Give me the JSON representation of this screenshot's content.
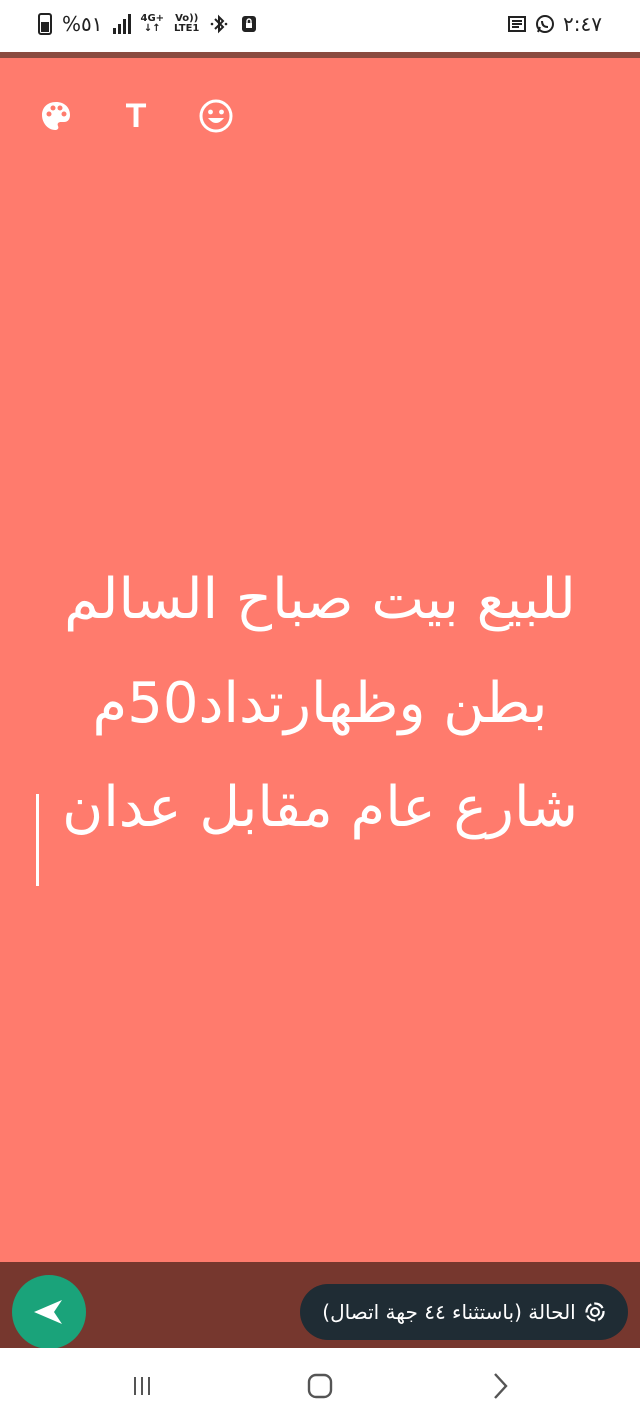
{
  "status_bar": {
    "battery_percent": "%٥١",
    "network_type": "4G+",
    "volte": "Vo))",
    "lte": "LTE1",
    "time": "٢:٤٧"
  },
  "toolbar": {
    "text_tool_label": "T"
  },
  "editor": {
    "status_text": "للبيع بيت صباح السالم\nبطن وظهارتداد50م\nشارع عام مقابل عدان",
    "background_color": "#ff7b6d"
  },
  "bottom": {
    "audience_label": "الحالة (باستثناء ٤٤ جهة اتصال)"
  },
  "colors": {
    "send_button": "#1aa37a",
    "pill_bg": "#1f2c34",
    "bottom_bar": "#76372e"
  }
}
